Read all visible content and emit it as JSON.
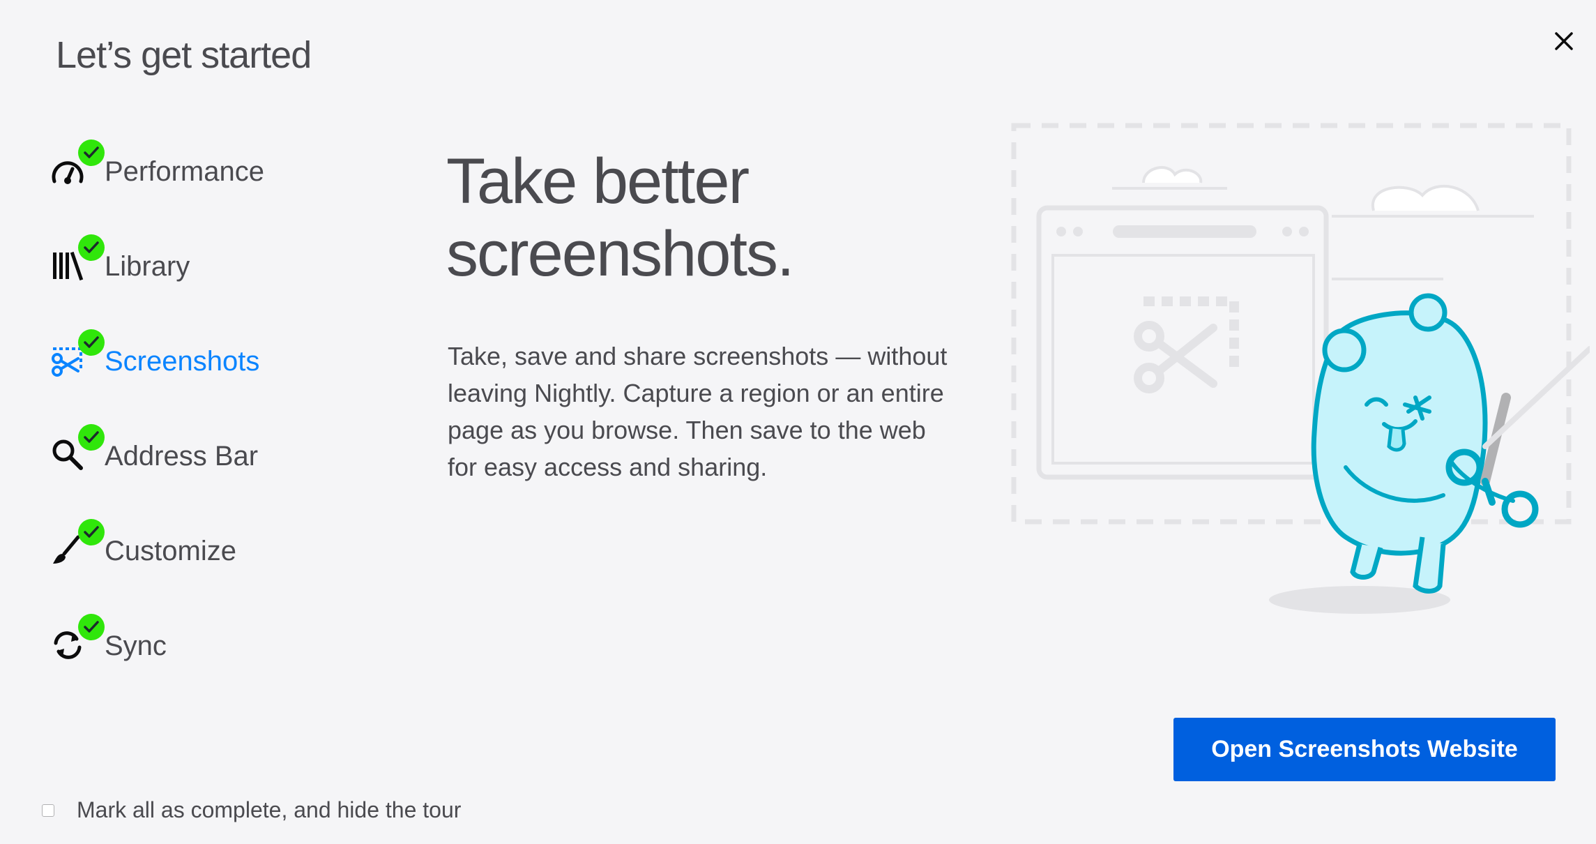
{
  "header": {
    "title": "Let’s get started"
  },
  "close": {
    "icon": "close-icon"
  },
  "nav": {
    "items": [
      {
        "label": "Performance",
        "icon": "speedometer-icon",
        "completed": true,
        "active": false
      },
      {
        "label": "Library",
        "icon": "library-icon",
        "completed": true,
        "active": false
      },
      {
        "label": "Screenshots",
        "icon": "screenshots-icon",
        "completed": true,
        "active": true
      },
      {
        "label": "Address Bar",
        "icon": "search-icon",
        "completed": true,
        "active": false
      },
      {
        "label": "Customize",
        "icon": "paintbrush-icon",
        "completed": true,
        "active": false
      },
      {
        "label": "Sync",
        "icon": "sync-icon",
        "completed": true,
        "active": false
      }
    ]
  },
  "content": {
    "headline_line1": "Take better",
    "headline_line2": "screenshots.",
    "description": "Take, save and share screenshots — without leaving Nightly. Capture a region or an entire page as you browse. Then save to the web for easy access and sharing.",
    "button_label": "Open Screenshots Website"
  },
  "footer": {
    "checkbox_label": "Mark all as complete, and hide the tour",
    "checked": false
  },
  "colors": {
    "accent": "#0a84ff",
    "button": "#0060df",
    "check_badge": "#30e60b",
    "text": "#4a4a4f",
    "background": "#f5f5f7"
  }
}
